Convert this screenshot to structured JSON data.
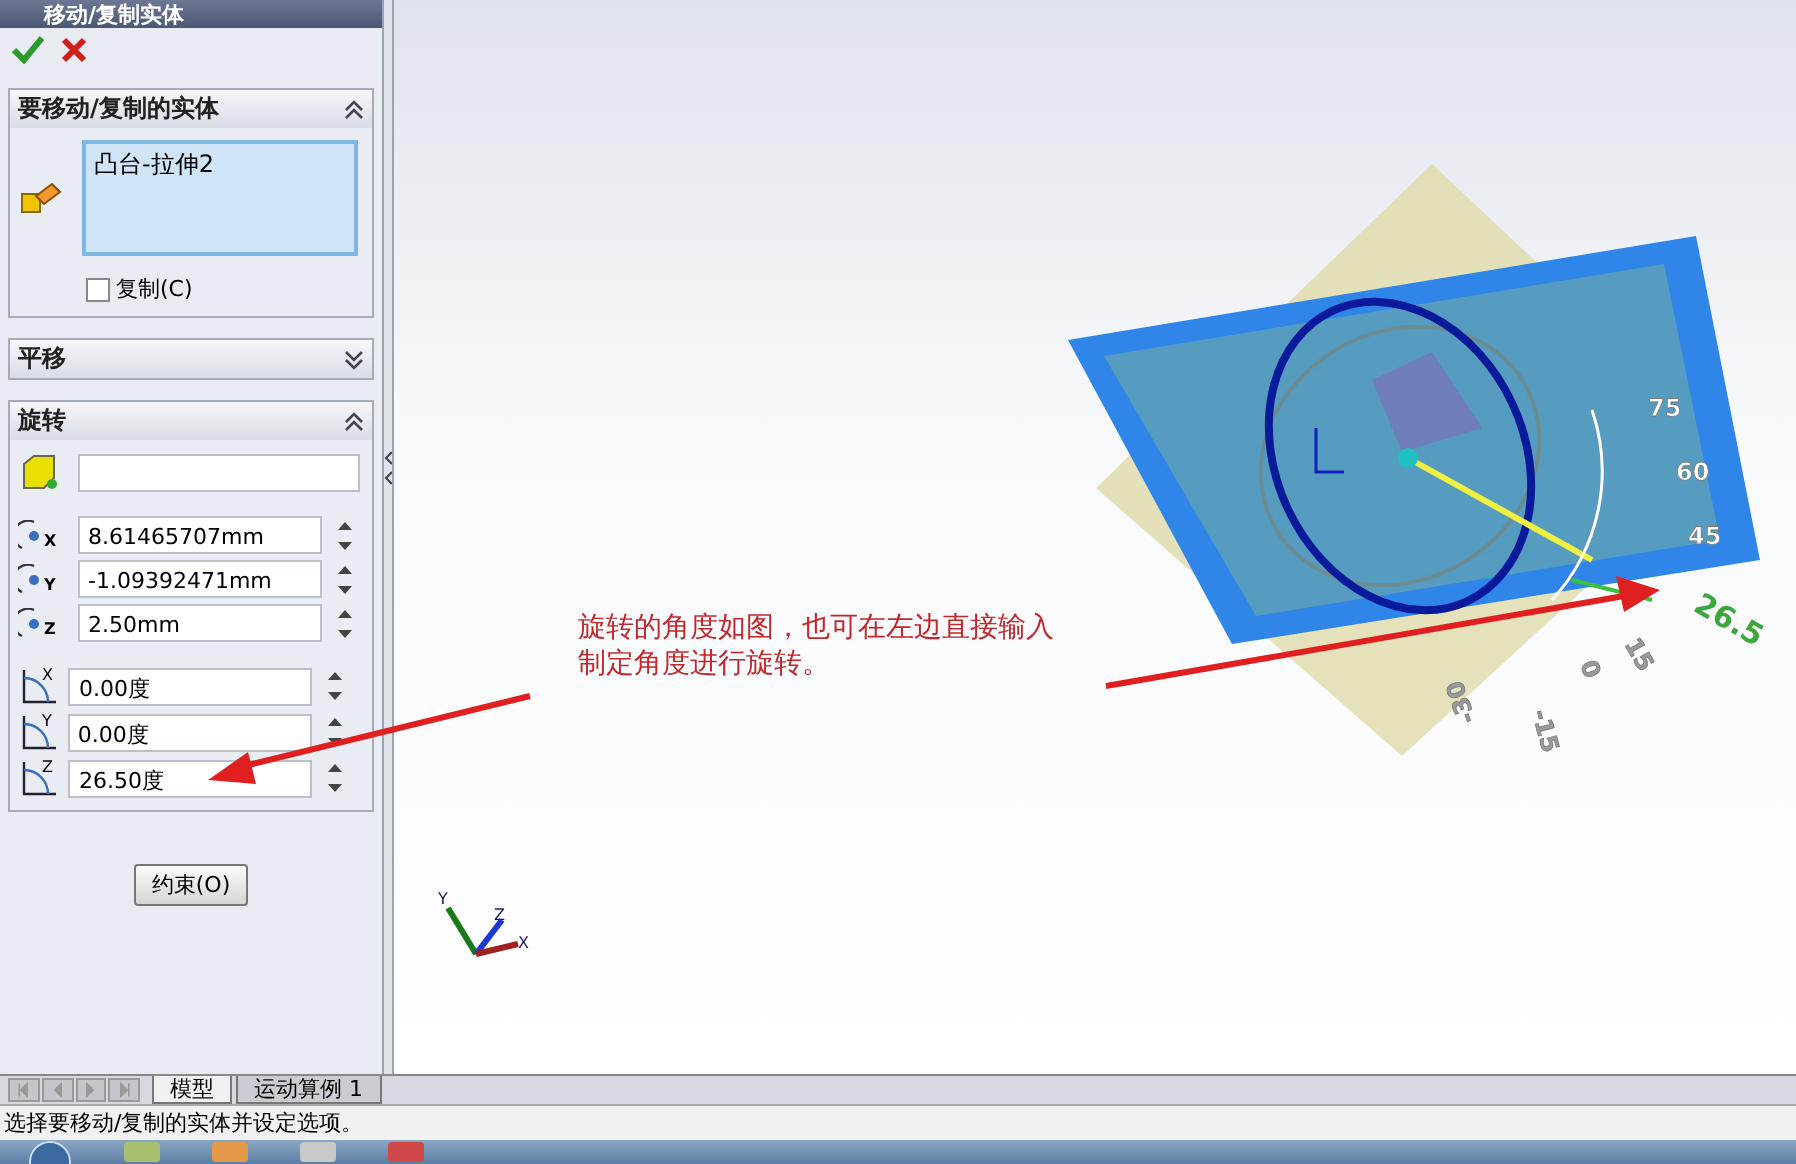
{
  "window": {
    "title": "移动/复制实体"
  },
  "sections": [
    {
      "kind": "bodies",
      "title": "要移动/复制的实体",
      "expanded": true
    },
    {
      "kind": "translate",
      "title": "平移",
      "expanded": false
    },
    {
      "kind": "rotate",
      "title": "旋转",
      "expanded": true
    }
  ],
  "bodies": {
    "items": [
      "凸台-拉伸2"
    ],
    "copy": {
      "label": "复制(C)",
      "checked": false
    }
  },
  "rotation": {
    "center": [
      {
        "axis": "X",
        "value": "8.61465707mm"
      },
      {
        "axis": "Y",
        "value": "-1.09392471mm"
      },
      {
        "axis": "Z",
        "value": "2.50mm"
      }
    ],
    "angles": [
      {
        "axis": "X",
        "value": "0.00度"
      },
      {
        "axis": "Y",
        "value": "0.00度"
      },
      {
        "axis": "Z",
        "value": "26.50度"
      }
    ]
  },
  "constraint_button": "约束(O)",
  "annotation": "旋转的角度如图，也可在左边直接输入制定角度进行旋转。",
  "scale_labels": [
    {
      "text": "75",
      "selected": false
    },
    {
      "text": "60",
      "selected": false
    },
    {
      "text": "45",
      "selected": false
    },
    {
      "text": "26.5",
      "selected": true
    },
    {
      "text": "15",
      "selected": false
    },
    {
      "text": "0",
      "selected": false
    },
    {
      "text": "-15",
      "selected": false
    },
    {
      "text": "-30",
      "selected": false
    }
  ],
  "triad": [
    "X",
    "Y",
    "Z"
  ],
  "bottom_tabs": [
    {
      "label": "模型",
      "selected": true
    },
    {
      "label": "运动算例 1",
      "selected": false
    }
  ],
  "status_bar": "选择要移动/复制的实体并设定选项。"
}
